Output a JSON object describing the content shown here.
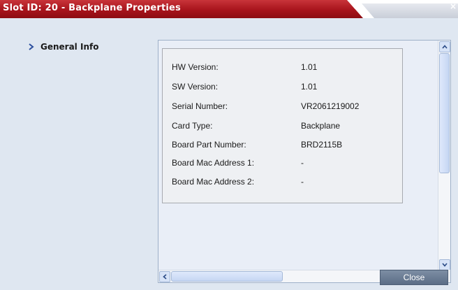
{
  "window": {
    "title": "Slot ID: 20 - Backplane Properties",
    "close_glyph": "×"
  },
  "nav": {
    "items": [
      {
        "label": "General Info",
        "icon": "chevron-right-icon",
        "selected": true
      }
    ]
  },
  "info": {
    "rows": [
      {
        "label": "HW Version:",
        "value": "1.01"
      },
      {
        "label": "SW Version:",
        "value": "1.01"
      },
      {
        "label": "Serial Number:",
        "value": "VR2061219002"
      },
      {
        "label": "Card Type:",
        "value": "Backplane"
      },
      {
        "label": "Board Part Number:",
        "value": "BRD2115B"
      },
      {
        "label": "Board Mac Address 1:",
        "value": "-"
      },
      {
        "label": "Board Mac Address 2:",
        "value": "-"
      }
    ]
  },
  "footer": {
    "close_label": "Close"
  },
  "colors": {
    "title_red": "#a8141c",
    "content_bg": "#dfe7f1",
    "button_bg": "#6b7d96",
    "chevron_blue": "#2c4f9e"
  }
}
